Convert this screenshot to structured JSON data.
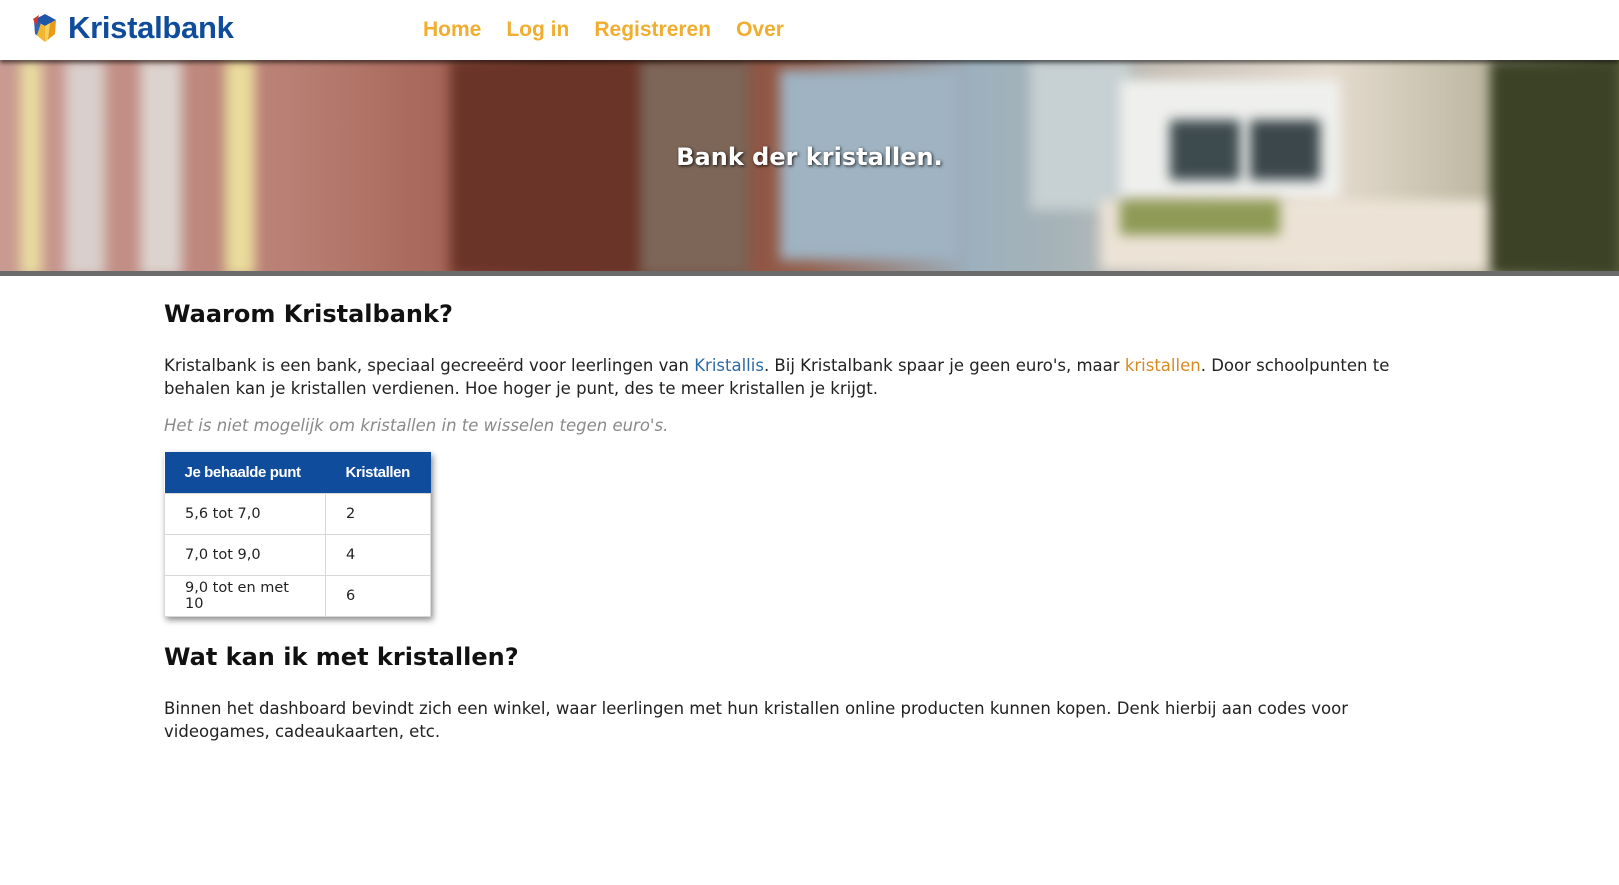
{
  "navbar": {
    "brand": "Kristalbank",
    "links": [
      "Home",
      "Log in",
      "Registreren",
      "Over"
    ]
  },
  "hero": {
    "title": "Bank der kristallen."
  },
  "section1": {
    "heading": "Waarom Kristalbank?",
    "para_1": "Kristalbank is een bank, speciaal gecreeërd voor leerlingen van ",
    "link_kristallis": "Kristallis",
    "para_2": ". Bij Kristalbank spaar je geen euro's, maar ",
    "link_kristallen": "kristallen",
    "para_3": ". Door schoolpunten te behalen kan je kristallen verdienen. Hoe hoger je punt, des te meer kristallen je krijgt.",
    "note": "Het is niet mogelijk om kristallen in te wisselen tegen euro's."
  },
  "table": {
    "headers": [
      "Je behaalde punt",
      "Kristallen"
    ],
    "rows": [
      [
        "5,6 tot 7,0",
        "2"
      ],
      [
        "7,0 tot 9,0",
        "4"
      ],
      [
        "9,0 tot en met 10",
        "6"
      ]
    ]
  },
  "section2": {
    "heading": "Wat kan ik met kristallen?",
    "para": "Binnen het dashboard bevindt zich een winkel, waar leerlingen met hun kristallen online producten kunnen kopen. Denk hierbij aan codes voor videogames, cadeaukaarten, etc."
  },
  "colors": {
    "brand_blue": "#0f4c9c",
    "nav_orange": "#f0ad2e",
    "link_blue": "#2c6aa6",
    "link_orange": "#d68a20"
  },
  "icons": {
    "logo": "crystal-logo-icon"
  }
}
